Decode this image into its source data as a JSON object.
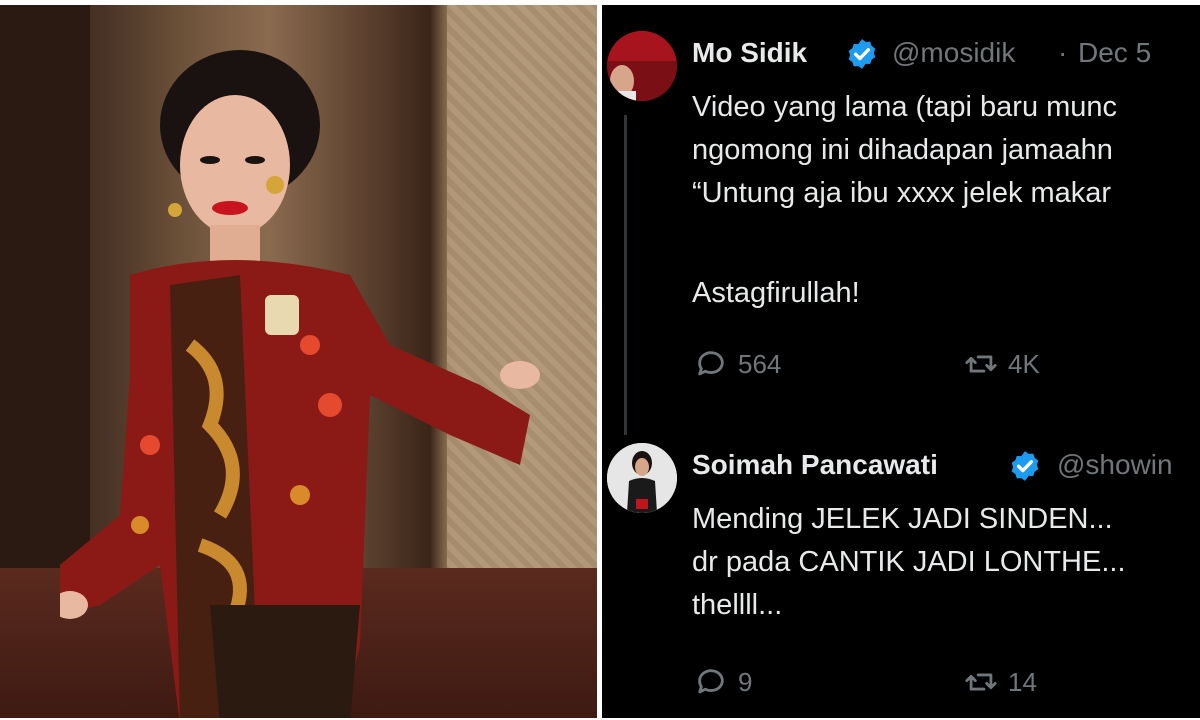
{
  "tweets": [
    {
      "name": "Mo Sidik",
      "handle": "@mosidik",
      "separator": "·",
      "date": "Dec 5",
      "lines": [
        "Video yang lama (tapi baru munc",
        "ngomong ini dihadapan jamaahn",
        "“Untung aja ibu xxxx jelek makar",
        "",
        "Astagfirullah!"
      ],
      "replies": "564",
      "retweets": "4K",
      "reply_icon": "reply-icon",
      "retweet_icon": "retweet-icon"
    },
    {
      "name": "Soimah Pancawati",
      "handle": "@showin",
      "lines": [
        "Mending JELEK JADI SINDEN...",
        "dr pada CANTIK JADI LONTHE...",
        "thellll..."
      ],
      "replies": "9",
      "retweets": "14",
      "reply_icon": "reply-icon",
      "retweet_icon": "retweet-icon"
    }
  ],
  "colors": {
    "background": "#000000",
    "text": "#e7e9ea",
    "muted": "#71767b",
    "verified": "#1d9bf0"
  }
}
